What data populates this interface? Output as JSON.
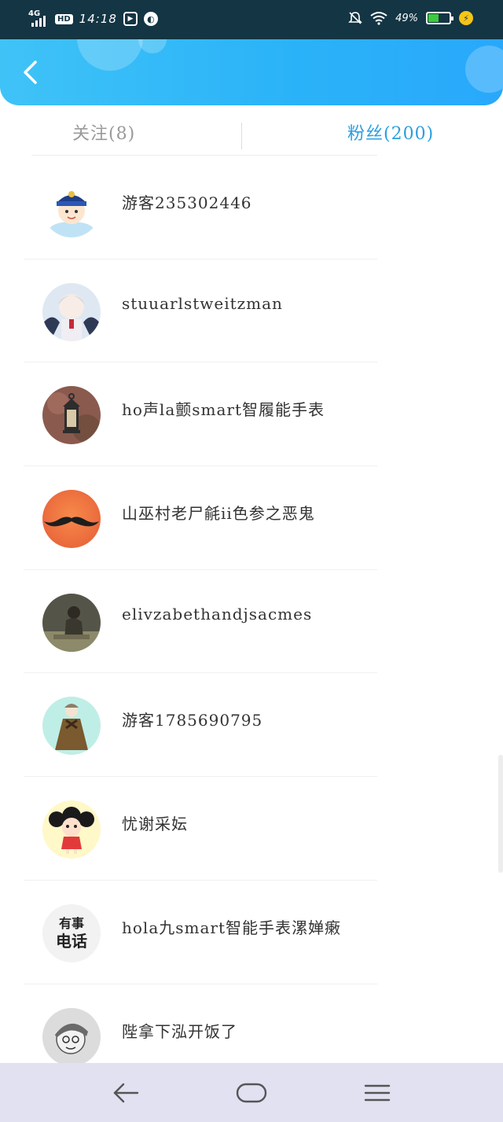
{
  "status_bar": {
    "network": "4G",
    "hd": "HD",
    "time": "14:18",
    "battery_percent": "49%",
    "battery_level": 0.49,
    "icons": [
      "signal-icon",
      "hd-icon",
      "play-icon",
      "compass-icon",
      "bell-off-icon",
      "wifi-icon",
      "battery-icon",
      "charging-icon"
    ]
  },
  "header": {
    "back_icon": "chevron-left-icon",
    "background_color": "#2ab2f8"
  },
  "tabs": [
    {
      "label": "关注(8)",
      "active": false
    },
    {
      "label": "粉丝(200)",
      "active": true
    }
  ],
  "accent_color": "#2b9fe0",
  "fans": [
    {
      "name": "游客235302446",
      "avatar": "cartoon-boy-hat"
    },
    {
      "name": "stuuarlstweitzman",
      "avatar": "anime-white-hair"
    },
    {
      "name": "ho声la颤smart智履能手表",
      "avatar": "lantern"
    },
    {
      "name": "山巫村老尸毹ii色参之恶鬼",
      "avatar": "mustache"
    },
    {
      "name": "elivzabethandjsacmes",
      "avatar": "person-sitting"
    },
    {
      "name": "游客1785690795",
      "avatar": "girl-drawing"
    },
    {
      "name": "忧谢采妘",
      "avatar": "cartoon-girl-red"
    },
    {
      "name": "hola九smart智能手表漯婵瘷",
      "avatar": "text-avatar",
      "avatar_text": [
        "有事",
        "电话"
      ]
    },
    {
      "name": "陛拿下泓开饭了",
      "avatar": "sketch-boy"
    }
  ],
  "nav_bar": {
    "icons": [
      "back-triangle-icon",
      "home-pill-icon",
      "menu-lines-icon"
    ]
  }
}
